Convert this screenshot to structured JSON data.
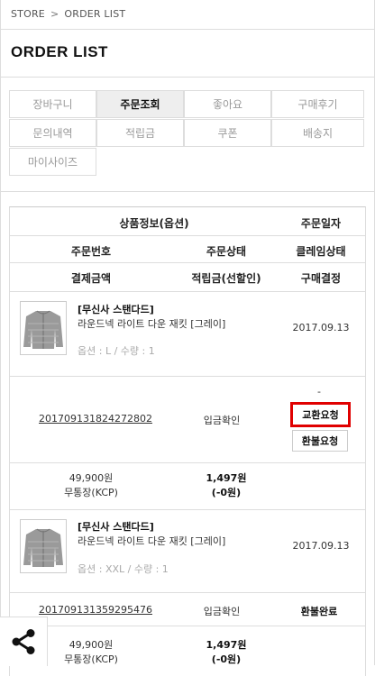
{
  "breadcrumb": {
    "home": "STORE",
    "separator": ">",
    "current": "ORDER LIST"
  },
  "page_title": "ORDER LIST",
  "tabs": [
    {
      "label": "장바구니",
      "active": false
    },
    {
      "label": "주문조회",
      "active": true
    },
    {
      "label": "좋아요",
      "active": false
    },
    {
      "label": "구매후기",
      "active": false
    },
    {
      "label": "문의내역",
      "active": false
    },
    {
      "label": "적립금",
      "active": false
    },
    {
      "label": "쿠폰",
      "active": false
    },
    {
      "label": "배송지",
      "active": false
    },
    {
      "label": "마이사이즈",
      "active": false
    }
  ],
  "table": {
    "headers": {
      "product_info": "상품정보(옵션)",
      "order_date": "주문일자",
      "order_number": "주문번호",
      "order_status": "주문상태",
      "claim_status": "클레임상태",
      "payment_amount": "결제금액",
      "points": "적립금(선할인)",
      "purchase_confirm": "구매결정"
    },
    "orders": [
      {
        "brand": "[무신사 스탠다드]",
        "product_name": "라운드넥 라이트 다운 재킷 [그레이]",
        "option": "옵션 : L / 수량 : 1",
        "order_date": "2017.09.13",
        "order_number": "201709131824272802",
        "order_status": "입금확인",
        "claim_status": "-",
        "exchange_button": "교환요청",
        "refund_button": "환불요청",
        "amount": "49,900원",
        "payment_method": "무통장(KCP)",
        "points": "1,497원",
        "points_discount": "(-0원)"
      },
      {
        "brand": "[무신사 스탠다드]",
        "product_name": "라운드넥 라이트 다운 재킷 [그레이]",
        "option": "옵션 : XXL / 수량 : 1",
        "order_date": "2017.09.13",
        "order_number": "201709131359295476",
        "order_status": "입금확인",
        "claim_status": "환불완료",
        "amount": "49,900원",
        "payment_method": "무통장(KCP)",
        "points": "1,497원",
        "points_discount": "(-0원)"
      }
    ]
  },
  "icons": {
    "share": "share-icon",
    "product_image": "down-jacket-thumbnail"
  },
  "colors": {
    "highlight_border": "#e00000",
    "active_tab_bg": "#eeeeee"
  }
}
